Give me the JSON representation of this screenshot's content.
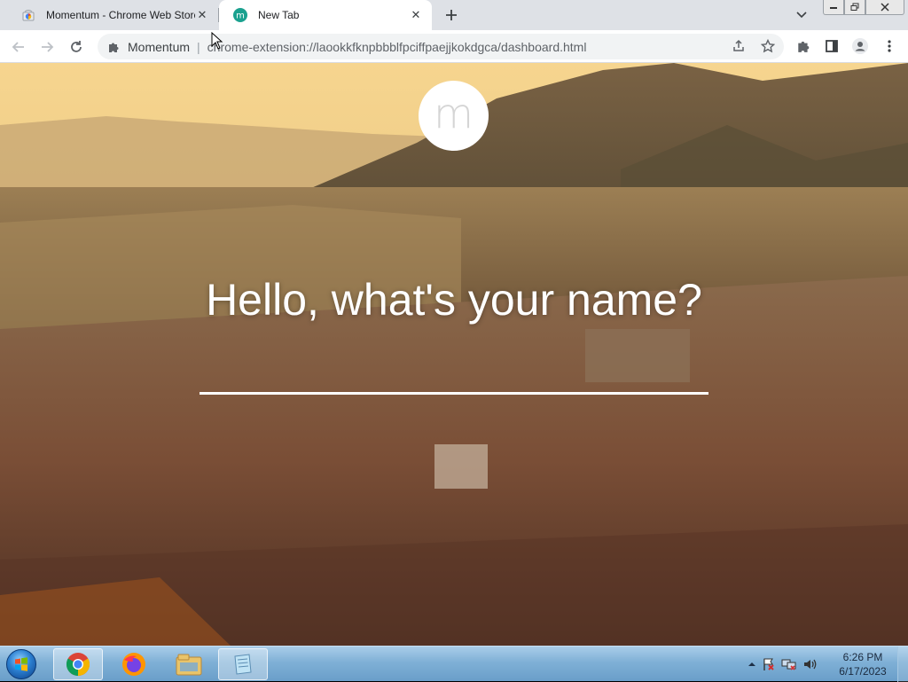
{
  "browser": {
    "tabs": [
      {
        "title": "Momentum - Chrome Web Store",
        "favicon": "chrome-web-store-icon",
        "active": false
      },
      {
        "title": "New Tab",
        "favicon": "momentum-icon",
        "active": true
      }
    ],
    "omnibox": {
      "site_chip": "Momentum",
      "url": "chrome-extension://laookkfknpbbblfpciffpaejjkokdgca/dashboard.html"
    }
  },
  "page": {
    "logo_letter": "m",
    "prompt": "Hello, what's your name?",
    "name_input_value": ""
  },
  "taskbar": {
    "pinned": [
      {
        "name": "chrome-icon"
      },
      {
        "name": "firefox-icon"
      },
      {
        "name": "file-explorer-icon"
      },
      {
        "name": "notepad-icon"
      }
    ],
    "clock": {
      "time": "6:26 PM",
      "date": "6/17/2023"
    }
  },
  "colors": {
    "tabstrip": "#dee1e6",
    "momentum_accent": "#1aa18f",
    "taskbar": "#7fb0d6"
  }
}
